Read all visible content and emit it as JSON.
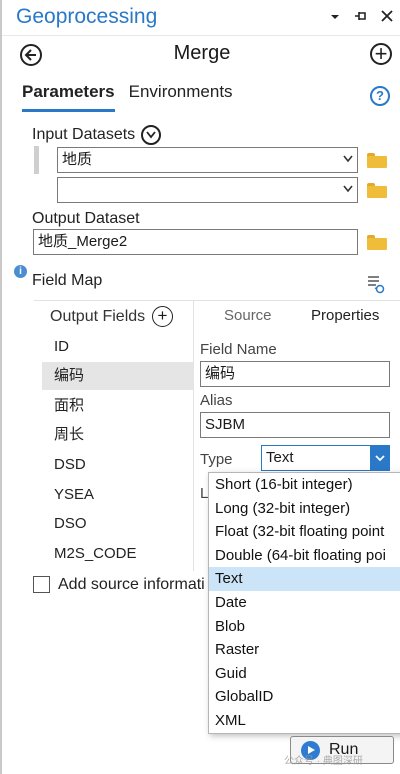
{
  "window": {
    "title": "Geoprocessing",
    "titlebar_icons": [
      "chevron-down-icon",
      "pin-icon",
      "close-icon"
    ]
  },
  "header": {
    "tool_title": "Merge"
  },
  "tabs": [
    {
      "label": "Parameters",
      "active": true
    },
    {
      "label": "Environments",
      "active": false
    }
  ],
  "input_datasets": {
    "label": "Input Datasets",
    "rows": [
      {
        "value": "地质"
      },
      {
        "value": ""
      }
    ]
  },
  "output_dataset": {
    "label": "Output Dataset",
    "value": "地质_Merge2"
  },
  "field_map": {
    "label": "Field Map",
    "output_fields_label": "Output Fields",
    "fields": [
      "ID",
      "编码",
      "面积",
      "周长",
      "DSD",
      "YSEA",
      "DSO",
      "M2S_CODE"
    ],
    "selected_field": "编码",
    "subtabs": [
      {
        "label": "Source",
        "active": false
      },
      {
        "label": "Properties",
        "active": true
      }
    ],
    "properties": {
      "field_name_label": "Field Name",
      "field_name_value": "编码",
      "alias_label": "Alias",
      "alias_value": "SJBM",
      "type_label": "Type",
      "type_value": "Text",
      "partial_label": "L"
    }
  },
  "type_options": [
    "Short (16-bit integer)",
    "Long (32-bit integer)",
    "Float (32-bit floating point",
    "Double (64-bit floating poi",
    "Text",
    "Date",
    "Blob",
    "Raster",
    "Guid",
    "GlobalID",
    "XML"
  ],
  "type_selected": "Text",
  "add_source_info": {
    "label": "Add source informati",
    "checked": false
  },
  "run_button": {
    "label": "Run"
  },
  "watermark": "公众号 · 典图深研",
  "colors": {
    "accent": "#2a78c8",
    "selected_option": "#cce4f7",
    "folder": "#f0bd3a"
  }
}
